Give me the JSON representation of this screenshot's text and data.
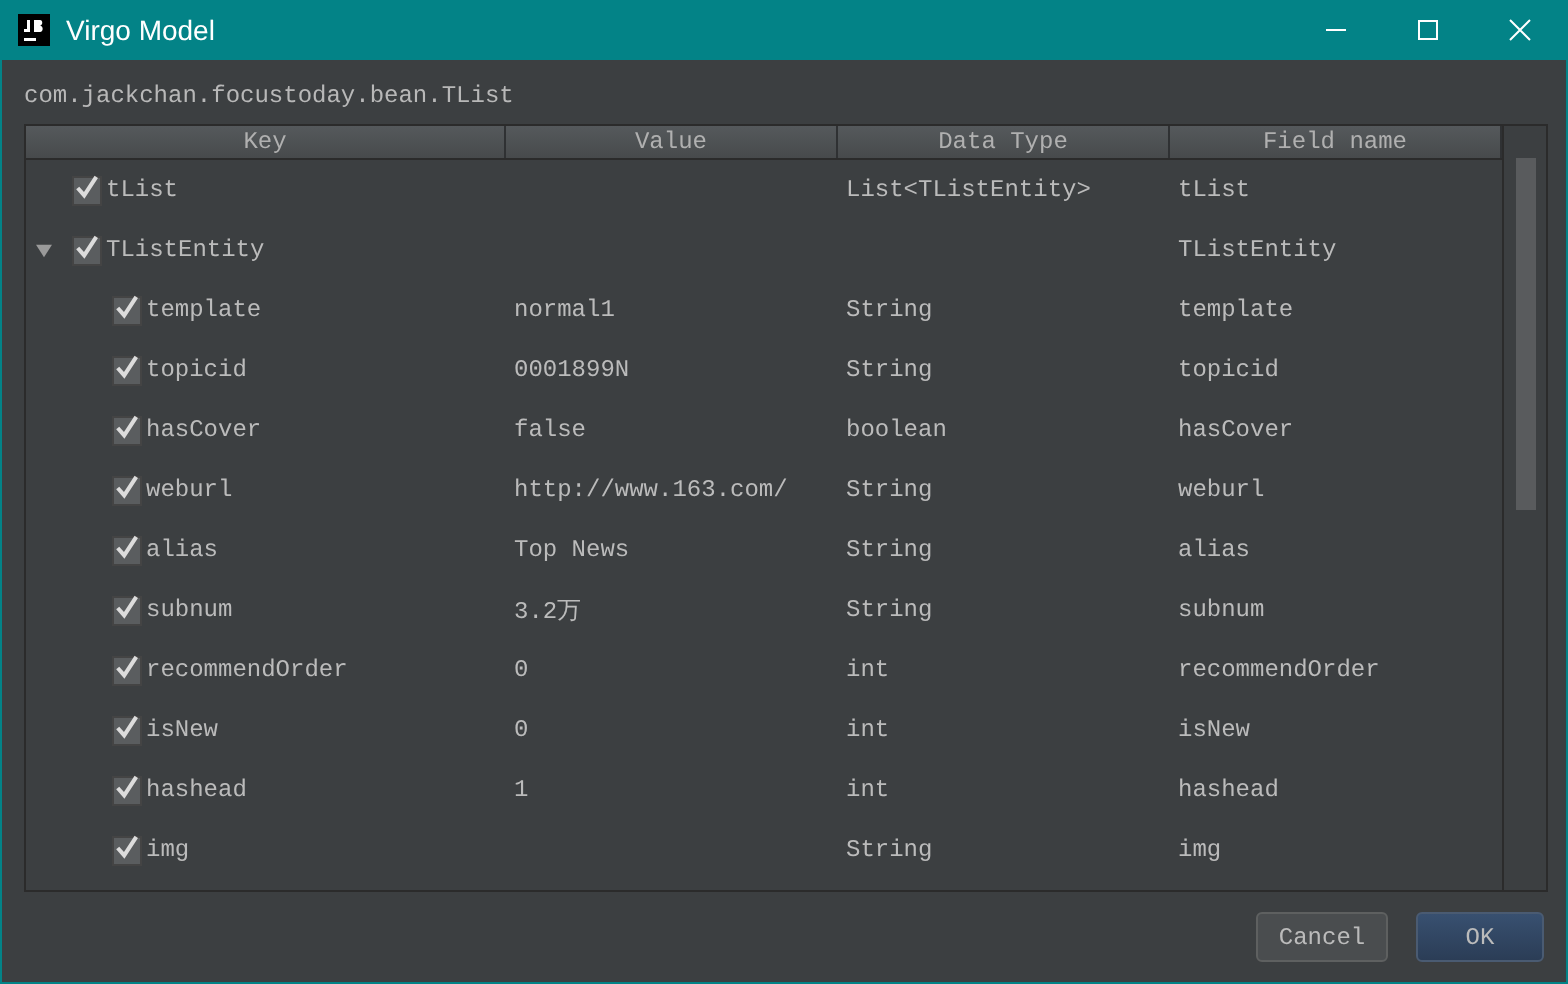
{
  "window": {
    "title": "Virgo Model"
  },
  "class_path": "com.jackchan.focustoday.bean.TList",
  "table": {
    "columns": [
      "Key",
      "Value",
      "Data Type",
      "Field name"
    ],
    "rows": [
      {
        "key": "tList",
        "data_type": "List<TListEntity>",
        "field_name": "tList",
        "checked": true
      },
      {
        "key": "TListEntity",
        "field_name": "TListEntity",
        "checked": true,
        "expanded": true,
        "children": [
          {
            "key": "template",
            "value": "normal1",
            "data_type": "String",
            "field_name": "template",
            "checked": true
          },
          {
            "key": "topicid",
            "value": "0001899N",
            "data_type": "String",
            "field_name": "topicid",
            "checked": true
          },
          {
            "key": "hasCover",
            "value": "false",
            "data_type": "boolean",
            "field_name": "hasCover",
            "checked": true
          },
          {
            "key": "weburl",
            "value": "http://www.163.com/",
            "data_type": "String",
            "field_name": "weburl",
            "checked": true
          },
          {
            "key": "alias",
            "value": "Top News",
            "data_type": "String",
            "field_name": "alias",
            "checked": true
          },
          {
            "key": "subnum",
            "value": "3.2万",
            "data_type": "String",
            "field_name": "subnum",
            "checked": true
          },
          {
            "key": "recommendOrder",
            "value": "0",
            "data_type": "int",
            "field_name": "recommendOrder",
            "checked": true
          },
          {
            "key": "isNew",
            "value": "0",
            "data_type": "int",
            "field_name": "isNew",
            "checked": true
          },
          {
            "key": "hashead",
            "value": "1",
            "data_type": "int",
            "field_name": "hashead",
            "checked": true
          },
          {
            "key": "img",
            "data_type": "String",
            "field_name": "img",
            "checked": true
          }
        ]
      }
    ]
  },
  "buttons": [
    {
      "label": "Cancel",
      "default": false
    },
    {
      "label": "OK",
      "default": true
    }
  ]
}
